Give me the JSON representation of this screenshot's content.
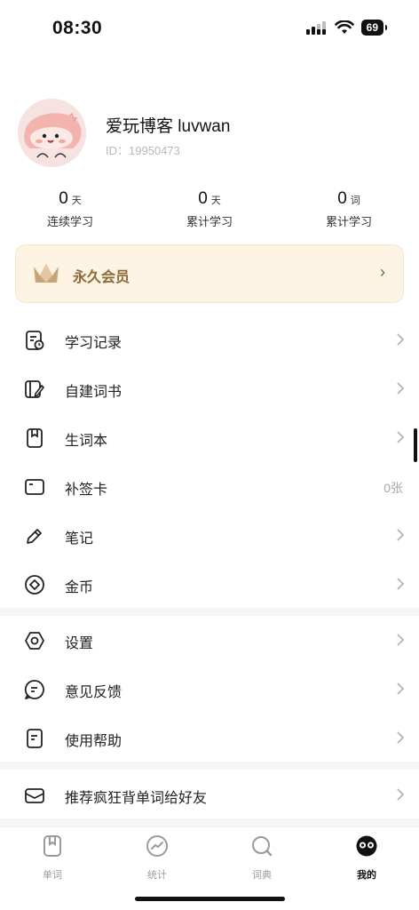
{
  "status_bar": {
    "time": "08:30",
    "battery": "69"
  },
  "profile": {
    "name": "爱玩博客 luvwan",
    "id": "ID：19950473"
  },
  "stats": [
    {
      "value": "0",
      "unit": "天",
      "label": "连续学习"
    },
    {
      "value": "0",
      "unit": "天",
      "label": "累计学习"
    },
    {
      "value": "0",
      "unit": "词",
      "label": "累计学习"
    }
  ],
  "vip": {
    "label": "永久会员",
    "arrow": "›"
  },
  "menu": [
    {
      "label": "学习记录",
      "icon": "study-record-icon"
    },
    {
      "label": "自建词书",
      "icon": "custom-book-icon"
    },
    {
      "label": "生词本",
      "icon": "bookmark-book-icon"
    },
    {
      "label": "补签卡",
      "icon": "card-icon",
      "value": "0张"
    },
    {
      "label": "笔记",
      "icon": "pencil-icon"
    },
    {
      "label": "金币",
      "icon": "coin-icon"
    }
  ],
  "menu2": [
    {
      "label": "设置",
      "icon": "gear-icon"
    },
    {
      "label": "意见反馈",
      "icon": "feedback-icon"
    },
    {
      "label": "使用帮助",
      "icon": "help-doc-icon"
    }
  ],
  "menu3": [
    {
      "label": "推荐疯狂背单词给好友",
      "icon": "mail-share-icon"
    }
  ],
  "tabs": [
    {
      "label": "单词",
      "icon": "book-icon",
      "active": false
    },
    {
      "label": "统计",
      "icon": "chart-icon",
      "active": false
    },
    {
      "label": "词典",
      "icon": "search-icon",
      "active": false
    },
    {
      "label": "我的",
      "icon": "profile-face-icon",
      "active": true
    }
  ],
  "colors": {
    "vip_bg": "#fcf3e3",
    "vip_text": "#8a6a36",
    "avatar_bg": "#f7dede"
  }
}
